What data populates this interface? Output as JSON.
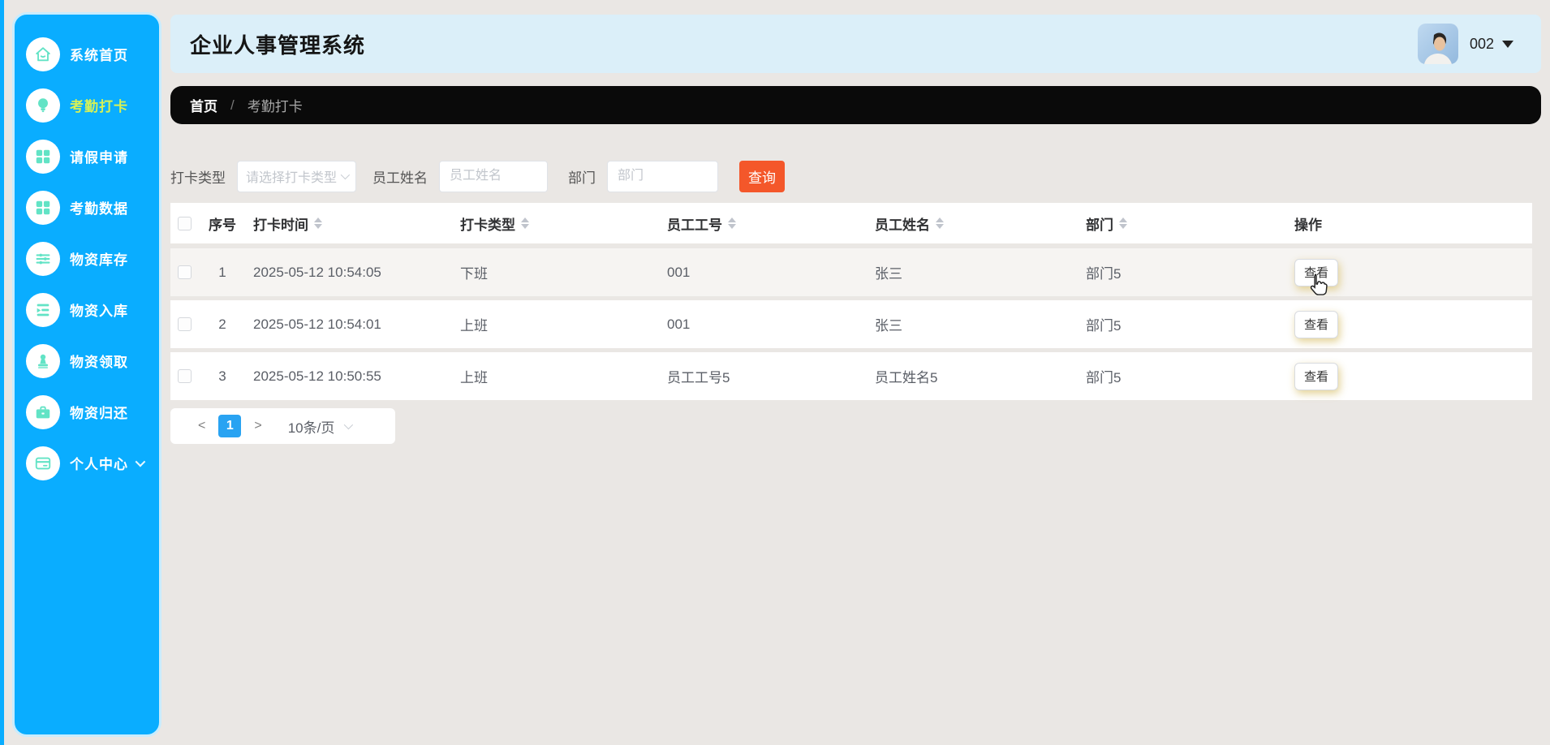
{
  "app": {
    "title": "企业人事管理系统",
    "user": "002"
  },
  "colors": {
    "sidebar_blue": "#0AADFF",
    "icon_mint": "#62E3C5",
    "active_item_lime": "#D6F157",
    "header_bg": "#DBEFF9",
    "breadcrumb_bg": "#0A0A0A",
    "search_button_orange": "#F4572A",
    "active_page_blue": "#29A3F2",
    "page_bg": "#EAE7E4"
  },
  "sidebar": {
    "items": [
      {
        "label": "系统首页",
        "icon": "home-icon",
        "active": false
      },
      {
        "label": "考勤打卡",
        "icon": "bulb-icon",
        "active": true
      },
      {
        "label": "请假申请",
        "icon": "grid-icon",
        "active": false
      },
      {
        "label": "考勤数据",
        "icon": "grid-icon",
        "active": false
      },
      {
        "label": "物资库存",
        "icon": "sliders-icon",
        "active": false
      },
      {
        "label": "物资入库",
        "icon": "list-icon",
        "active": false
      },
      {
        "label": "物资领取",
        "icon": "stamp-icon",
        "active": false
      },
      {
        "label": "物资归还",
        "icon": "briefcase-icon",
        "active": false
      },
      {
        "label": "个人中心",
        "icon": "card-icon",
        "active": false,
        "expandable": true
      }
    ]
  },
  "breadcrumb": {
    "home": "首页",
    "separator": "/",
    "current": "考勤打卡"
  },
  "filters": {
    "type_label": "打卡类型",
    "type_placeholder": "请选择打卡类型",
    "name_label": "员工姓名",
    "name_placeholder": "员工姓名",
    "name_value": "",
    "dept_label": "部门",
    "dept_placeholder": "部门",
    "dept_value": "",
    "search_label": "查询"
  },
  "table": {
    "columns": [
      {
        "label": "序号",
        "sortable": false
      },
      {
        "label": "打卡时间",
        "sortable": true
      },
      {
        "label": "打卡类型",
        "sortable": true
      },
      {
        "label": "员工工号",
        "sortable": true
      },
      {
        "label": "员工姓名",
        "sortable": true
      },
      {
        "label": "部门",
        "sortable": true
      },
      {
        "label": "操作",
        "sortable": false
      }
    ],
    "rows": [
      {
        "index": "1",
        "time": "2025-05-12 10:54:05",
        "type": "下班",
        "emp_id": "001",
        "emp_name": "张三",
        "dept": "部门5",
        "action": "查看"
      },
      {
        "index": "2",
        "time": "2025-05-12 10:54:01",
        "type": "上班",
        "emp_id": "001",
        "emp_name": "张三",
        "dept": "部门5",
        "action": "查看"
      },
      {
        "index": "3",
        "time": "2025-05-12 10:50:55",
        "type": "上班",
        "emp_id": "员工工号5",
        "emp_name": "员工姓名5",
        "dept": "部门5",
        "action": "查看"
      }
    ]
  },
  "pagination": {
    "prev": "<",
    "page": "1",
    "next": ">",
    "page_size": "10条/页"
  }
}
